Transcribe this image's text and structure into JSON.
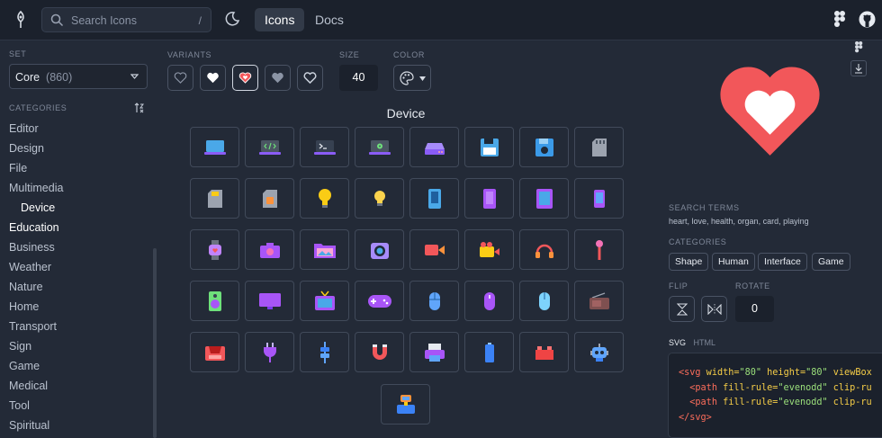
{
  "search": {
    "placeholder": "Search Icons",
    "shortcut": "/"
  },
  "nav": {
    "tabs": [
      {
        "label": "Icons",
        "active": true
      },
      {
        "label": "Docs",
        "active": false
      }
    ]
  },
  "sidebar": {
    "set_label": "SET",
    "set": {
      "name": "Core",
      "count": "(860)"
    },
    "categories_label": "CATEGORIES",
    "categories": [
      {
        "label": "Editor"
      },
      {
        "label": "Design"
      },
      {
        "label": "File"
      },
      {
        "label": "Multimedia"
      },
      {
        "label": "Device",
        "selected": true
      },
      {
        "label": "Education"
      },
      {
        "label": "Business"
      },
      {
        "label": "Weather"
      },
      {
        "label": "Nature"
      },
      {
        "label": "Home"
      },
      {
        "label": "Transport"
      },
      {
        "label": "Sign"
      },
      {
        "label": "Game"
      },
      {
        "label": "Medical"
      },
      {
        "label": "Tool"
      },
      {
        "label": "Spiritual"
      }
    ]
  },
  "controls": {
    "variants_label": "VARIANTS",
    "size_label": "SIZE",
    "size_value": "40",
    "color_label": "COLOR",
    "selected_variant_index": 2
  },
  "grid": {
    "title": "Device",
    "icons": [
      "laptop-icon",
      "laptop-code-icon",
      "laptop-terminal-icon",
      "laptop-settings-icon",
      "hard-drive-icon",
      "floppy-disk-icon",
      "floppy-disk-blue-icon",
      "sd-card-icon",
      "sd-card-small-icon",
      "sim-card-icon",
      "lightbulb-icon",
      "lightbulb-small-icon",
      "tablet-icon",
      "tablet-purple-icon",
      "ipad-icon",
      "smartphone-icon",
      "smartwatch-icon",
      "camera-icon",
      "photo-folder-icon",
      "polaroid-camera-icon",
      "video-camera-icon",
      "movie-camera-icon",
      "headphones-icon",
      "microphone-icon",
      "speaker-icon",
      "monitor-icon",
      "tv-icon",
      "gamepad-icon",
      "mouse-icon",
      "mouse-purple-icon",
      "mouse-light-icon",
      "radio-icon",
      "printer-3d-icon",
      "plug-icon",
      "plug-connector-icon",
      "magnet-icon",
      "printer-icon",
      "battery-icon",
      "lego-brick-icon",
      "robot-icon",
      "vr-headset-icon"
    ]
  },
  "preview": {
    "icon": "heart-icon",
    "color": "#f2575a"
  },
  "details": {
    "search_terms_label": "SEARCH TERMS",
    "search_terms": "heart, love, health, organ, card, playing",
    "categories_label": "CATEGORIES",
    "categories": [
      "Shape",
      "Human",
      "Interface",
      "Game"
    ],
    "flip_label": "FLIP",
    "rotate_label": "ROTATE",
    "rotate_value": "0"
  },
  "code": {
    "tabs": [
      {
        "label": "SVG",
        "active": true
      },
      {
        "label": "HTML",
        "active": false
      }
    ],
    "line1": {
      "tag": "<svg",
      "a1": " width=",
      "v1": "\"80\"",
      "a2": " height=",
      "v2": "\"80\"",
      "a3": " viewBox"
    },
    "line2": {
      "tag": "<path",
      "a1": " fill-rule=",
      "v1": "\"evenodd\"",
      "a2": " clip-ru"
    },
    "line3": {
      "tag": "<path",
      "a1": " fill-rule=",
      "v1": "\"evenodd\"",
      "a2": " clip-ru"
    },
    "line4": {
      "tag": "</svg>"
    }
  },
  "colors": {
    "accent_red": "#f2575a",
    "bg": "#232a37",
    "topbar": "#1b212c"
  }
}
